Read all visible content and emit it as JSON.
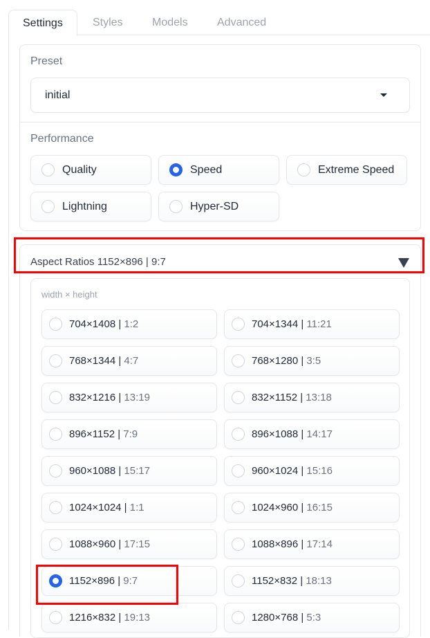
{
  "tabs": [
    {
      "label": "Settings",
      "active": true
    },
    {
      "label": "Styles",
      "active": false
    },
    {
      "label": "Models",
      "active": false
    },
    {
      "label": "Advanced",
      "active": false
    }
  ],
  "preset": {
    "label": "Preset",
    "value": "initial",
    "icon": "caret-down-icon"
  },
  "performance": {
    "label": "Performance",
    "options": [
      {
        "label": "Quality",
        "checked": false
      },
      {
        "label": "Speed",
        "checked": true
      },
      {
        "label": "Extreme Speed",
        "checked": false
      },
      {
        "label": "Lightning",
        "checked": false
      },
      {
        "label": "Hyper-SD",
        "checked": false
      }
    ]
  },
  "aspect_ratios": {
    "title": "Aspect Ratios 1152×896 | 9:7",
    "expanded": true,
    "icon": "triangle-down-icon",
    "group_label": "width × height",
    "options": [
      {
        "size": "704×1408",
        "ratio": "1:2",
        "checked": false
      },
      {
        "size": "704×1344",
        "ratio": "11:21",
        "checked": false
      },
      {
        "size": "768×1344",
        "ratio": "4:7",
        "checked": false
      },
      {
        "size": "768×1280",
        "ratio": "3:5",
        "checked": false
      },
      {
        "size": "832×1216",
        "ratio": "13:19",
        "checked": false
      },
      {
        "size": "832×1152",
        "ratio": "13:18",
        "checked": false
      },
      {
        "size": "896×1152",
        "ratio": "7:9",
        "checked": false
      },
      {
        "size": "896×1088",
        "ratio": "14:17",
        "checked": false
      },
      {
        "size": "960×1088",
        "ratio": "15:17",
        "checked": false
      },
      {
        "size": "960×1024",
        "ratio": "15:16",
        "checked": false
      },
      {
        "size": "1024×1024",
        "ratio": "1:1",
        "checked": false
      },
      {
        "size": "1024×960",
        "ratio": "16:15",
        "checked": false
      },
      {
        "size": "1088×960",
        "ratio": "17:15",
        "checked": false
      },
      {
        "size": "1088×896",
        "ratio": "17:14",
        "checked": false
      },
      {
        "size": "1152×896",
        "ratio": "9:7",
        "checked": true
      },
      {
        "size": "1152×832",
        "ratio": "18:13",
        "checked": false
      },
      {
        "size": "1216×832",
        "ratio": "19:13",
        "checked": false
      },
      {
        "size": "1280×768",
        "ratio": "5:3",
        "checked": false
      }
    ]
  },
  "colors": {
    "accent": "#2563eb",
    "highlight": "#ff0000",
    "border": "#e5e7eb",
    "muted_text": "#6b7280"
  }
}
